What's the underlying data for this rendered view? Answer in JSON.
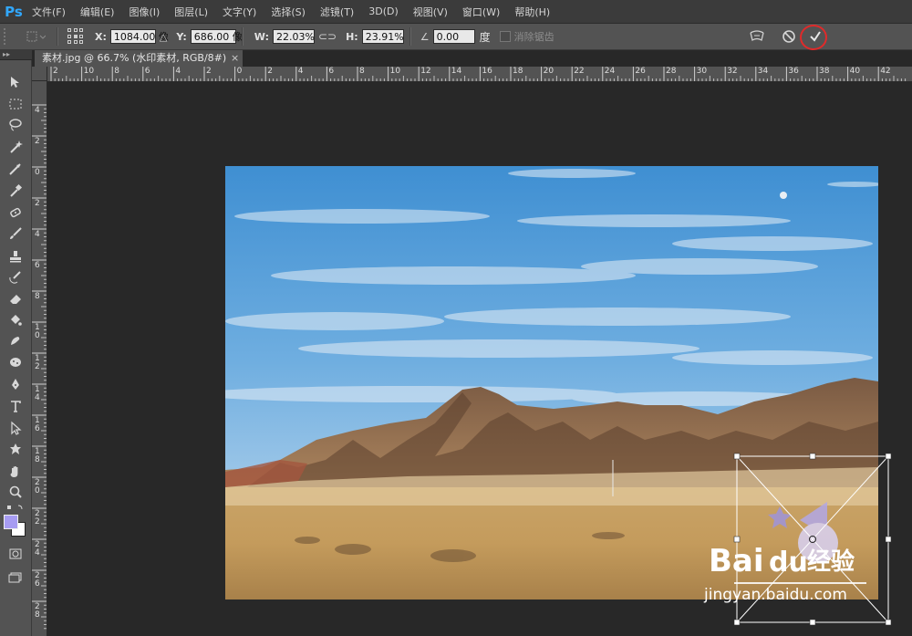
{
  "app": {
    "logo": "Ps"
  },
  "menus": [
    "文件(F)",
    "编辑(E)",
    "图像(I)",
    "图层(L)",
    "文字(Y)",
    "选择(S)",
    "滤镜(T)",
    "3D(D)",
    "视图(V)",
    "窗口(W)",
    "帮助(H)"
  ],
  "options": {
    "x_label": "X:",
    "x_value": "1084.00 像",
    "delta_icon": "delta-icon",
    "y_label": "Y:",
    "y_value": "686.00 像",
    "w_label": "W:",
    "w_value": "22.03%",
    "h_label": "H:",
    "h_value": "23.91%",
    "angle_value": "0.00",
    "angle_unit": "度",
    "antialias_label": "消除锯齿",
    "antialias_checked": false
  },
  "document": {
    "tab_title": "素材.jpg @ 66.7% (水印素材, RGB/8#)",
    "close": "×"
  },
  "rulers": {
    "h_labels": [
      "2",
      "10",
      "8",
      "6",
      "4",
      "2",
      "0",
      "2",
      "4",
      "6",
      "8",
      "10",
      "12",
      "14",
      "16",
      "18",
      "20",
      "22",
      "24",
      "26",
      "28",
      "30",
      "32",
      "34",
      "36",
      "38",
      "40",
      "42"
    ],
    "v_labels": [
      "4",
      "2",
      "0",
      "2",
      "4",
      "6",
      "8",
      "1\n0",
      "1\n2",
      "1\n4",
      "1\n6",
      "1\n8",
      "2\n0",
      "2\n2",
      "2\n4",
      "2\n6",
      "2\n8"
    ]
  },
  "watermark": {
    "text_main": "Bai",
    "text_paw": "du",
    "text_cn": "经验",
    "url": "jingyan.baidu.com"
  },
  "colors": {
    "accent": "#31a8ff",
    "highlight_ring": "#e02a2a",
    "foreground_swatch": "#a79cf2",
    "background_swatch": "#ffffff"
  }
}
